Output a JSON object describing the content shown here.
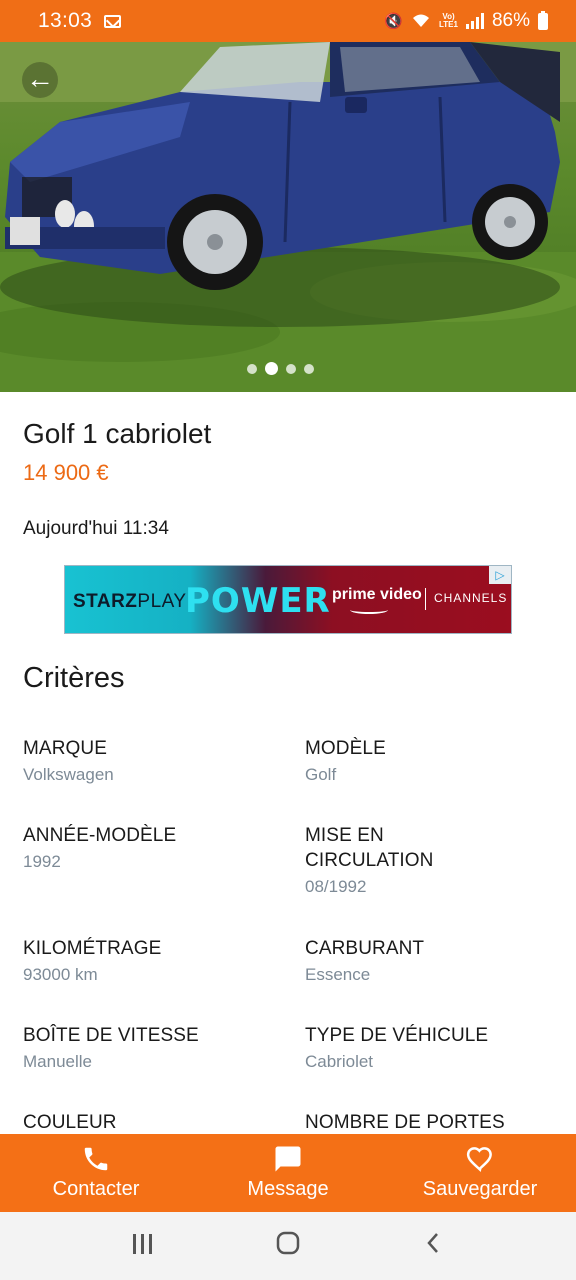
{
  "status_bar": {
    "time": "13:03",
    "signal_label": "Vo)) LTE1",
    "battery": "86%"
  },
  "gallery": {
    "image_count": 4,
    "active_index": 1
  },
  "listing": {
    "title": "Golf 1 cabriolet",
    "price": "14 900 €",
    "posted": "Aujourd'hui 11:34"
  },
  "ad": {
    "brand": "STARZPLAY",
    "brand_bold": "STARZ",
    "brand_light": "PLAY",
    "headline": "POWER",
    "partner": "prime video",
    "partner_suffix": "CHANNELS"
  },
  "criteria": {
    "heading": "Critères",
    "items": [
      {
        "label": "MARQUE",
        "value": "Volkswagen"
      },
      {
        "label": "MODÈLE",
        "value": "Golf"
      },
      {
        "label": "ANNÉE-MODÈLE",
        "value": "1992"
      },
      {
        "label": "MISE EN CIRCULATION",
        "value": "08/1992"
      },
      {
        "label": "KILOMÉTRAGE",
        "value": "93000 km"
      },
      {
        "label": "CARBURANT",
        "value": "Essence"
      },
      {
        "label": "BOÎTE DE VITESSE",
        "value": "Manuelle"
      },
      {
        "label": "TYPE DE VÉHICULE",
        "value": "Cabriolet"
      },
      {
        "label": "COULEUR",
        "value": ""
      },
      {
        "label": "NOMBRE DE PORTES",
        "value": ""
      }
    ]
  },
  "actions": {
    "contact": "Contacter",
    "message": "Message",
    "save": "Sauvegarder"
  },
  "colors": {
    "brand_orange": "#f47016",
    "price_orange": "#ec6a15",
    "value_grey": "#7d8a96"
  }
}
